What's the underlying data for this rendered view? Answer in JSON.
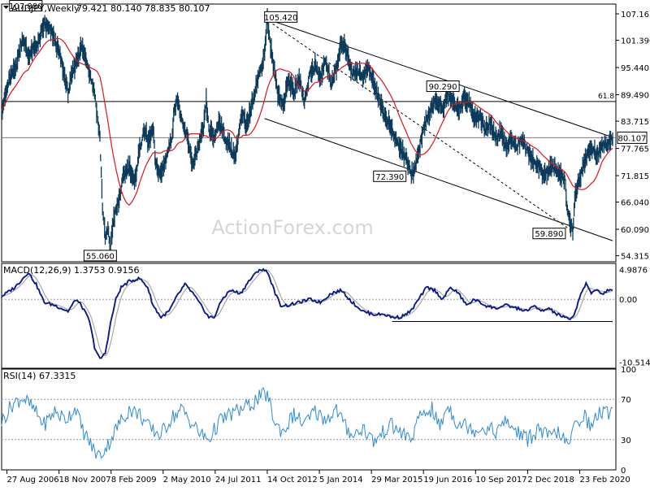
{
  "header": {
    "symbol_line": "AUDJPY,Weekly",
    "ohlc": "79.421 80.140 78.835 80.107"
  },
  "watermark": "ActionForex.com",
  "colors": {
    "price": "#0b3a5a",
    "sma": "#e0141b",
    "macd": "#0a1a8a",
    "signal": "#a8a8a8",
    "rsi": "#2e8bd6",
    "lines": "#000000",
    "current_price_box": "#000000"
  },
  "chart_data": [
    {
      "type": "line",
      "panel": "price",
      "title": "AUDJPY,Weekly",
      "y_ticks": [
        107.165,
        101.39,
        95.44,
        89.49,
        83.715,
        77.765,
        71.815,
        66.04,
        60.09,
        54.315
      ],
      "ylim": [
        53.0,
        109.3
      ],
      "x_ticks": [
        "27 Aug 2006",
        "18 Nov 2007",
        "8 Feb 2009",
        "2 May 2010",
        "24 Jul 2011",
        "14 Oct 2012",
        "5 Jan 2014",
        "29 Mar 2015",
        "19 Jun 2016",
        "10 Sep 2017",
        "2 Dec 2018",
        "23 Feb 2020"
      ],
      "current_price": "80.107",
      "fib_label": "61.8",
      "fib_level": 88.0,
      "annotations": [
        {
          "text": "107.880",
          "value": 107.88
        },
        {
          "text": "55.060",
          "value": 55.06
        },
        {
          "text": "105.420",
          "value": 105.42
        },
        {
          "text": "72.390",
          "value": 72.39
        },
        {
          "text": "90.290",
          "value": 90.29
        },
        {
          "text": "59.890",
          "value": 59.89
        }
      ],
      "price_keypoints": [
        [
          0,
          86
        ],
        [
          3,
          93
        ],
        [
          5,
          95
        ],
        [
          8,
          102
        ],
        [
          10,
          98
        ],
        [
          14,
          101
        ],
        [
          16,
          105
        ],
        [
          19,
          103
        ],
        [
          22,
          98
        ],
        [
          25,
          90
        ],
        [
          27,
          95
        ],
        [
          30,
          100
        ],
        [
          32,
          97
        ],
        [
          35,
          90
        ],
        [
          37,
          80
        ],
        [
          38,
          65
        ],
        [
          39,
          58
        ],
        [
          40,
          60
        ],
        [
          41,
          56
        ],
        [
          42,
          62
        ],
        [
          44,
          66
        ],
        [
          46,
          72
        ],
        [
          48,
          74
        ],
        [
          50,
          70
        ],
        [
          52,
          78
        ],
        [
          54,
          82
        ],
        [
          55,
          79
        ],
        [
          57,
          82
        ],
        [
          58,
          74
        ],
        [
          60,
          72
        ],
        [
          62,
          76
        ],
        [
          64,
          80
        ],
        [
          65,
          86
        ],
        [
          66,
          89
        ],
        [
          68,
          83
        ],
        [
          70,
          80
        ],
        [
          72,
          74
        ],
        [
          74,
          78
        ],
        [
          76,
          82
        ],
        [
          77,
          88
        ],
        [
          78,
          82
        ],
        [
          80,
          80
        ],
        [
          82,
          84
        ],
        [
          84,
          80
        ],
        [
          86,
          78
        ],
        [
          88,
          76
        ],
        [
          90,
          84
        ],
        [
          91,
          85
        ],
        [
          92,
          82
        ],
        [
          94,
          87
        ],
        [
          96,
          92
        ],
        [
          98,
          96
        ],
        [
          99,
          99
        ],
        [
          100,
          106
        ],
        [
          101,
          101
        ],
        [
          102,
          97
        ],
        [
          104,
          90
        ],
        [
          106,
          87
        ],
        [
          108,
          93
        ],
        [
          110,
          90
        ],
        [
          112,
          93
        ],
        [
          114,
          88
        ],
        [
          116,
          94
        ],
        [
          118,
          96
        ],
        [
          120,
          93
        ],
        [
          122,
          97
        ],
        [
          124,
          92
        ],
        [
          126,
          95
        ],
        [
          128,
          101
        ],
        [
          130,
          99
        ],
        [
          132,
          94
        ],
        [
          134,
          95
        ],
        [
          136,
          93
        ],
        [
          138,
          96
        ],
        [
          140,
          92
        ],
        [
          142,
          89
        ],
        [
          144,
          85
        ],
        [
          146,
          83
        ],
        [
          148,
          80
        ],
        [
          150,
          78
        ],
        [
          152,
          76
        ],
        [
          154,
          72
        ],
        [
          156,
          74
        ],
        [
          158,
          80
        ],
        [
          160,
          84
        ],
        [
          162,
          87
        ],
        [
          164,
          88
        ],
        [
          166,
          86
        ],
        [
          168,
          90
        ],
        [
          170,
          88
        ],
        [
          172,
          86
        ],
        [
          174,
          89
        ],
        [
          176,
          88
        ],
        [
          178,
          84
        ],
        [
          180,
          85
        ],
        [
          182,
          82
        ],
        [
          184,
          83
        ],
        [
          186,
          80
        ],
        [
          188,
          81
        ],
        [
          190,
          78
        ],
        [
          192,
          80
        ],
        [
          194,
          78
        ],
        [
          196,
          80
        ],
        [
          198,
          77
        ],
        [
          200,
          75
        ],
        [
          202,
          74
        ],
        [
          204,
          72
        ],
        [
          206,
          73
        ],
        [
          208,
          74
        ],
        [
          210,
          72
        ],
        [
          212,
          71
        ],
        [
          213,
          64
        ],
        [
          214,
          61
        ],
        [
          215,
          60
        ],
        [
          216,
          68
        ],
        [
          218,
          72
        ],
        [
          220,
          76
        ],
        [
          222,
          78
        ],
        [
          224,
          76
        ],
        [
          226,
          78
        ],
        [
          228,
          79
        ],
        [
          230,
          80.1
        ]
      ],
      "channel_lines": [
        {
          "from": [
            99,
            106.2
          ],
          "to": [
            230,
            80.2
          ]
        },
        {
          "from": [
            99,
            84.3
          ],
          "to": [
            230,
            57.6
          ]
        },
        {
          "from": [
            99,
            106.2
          ],
          "to": [
            215,
            59.6
          ]
        }
      ],
      "horizontal_line_level": 80.1,
      "series": [
        {
          "kind": "price"
        },
        {
          "kind": "moving-average"
        }
      ]
    },
    {
      "type": "line",
      "panel": "macd",
      "title": "MACD(12,26,9) 1.3753 0.9156",
      "y_ticks": [
        4.9876,
        0.0,
        -10.5142
      ],
      "ylim": [
        -11.5,
        6.0
      ],
      "support_level": -3.7,
      "keypoints": [
        [
          0,
          0.5
        ],
        [
          5,
          2
        ],
        [
          10,
          4.5
        ],
        [
          13,
          2.5
        ],
        [
          16,
          -0.5
        ],
        [
          20,
          -1
        ],
        [
          25,
          -2
        ],
        [
          28,
          0
        ],
        [
          30,
          -1
        ],
        [
          33,
          -3.5
        ],
        [
          35,
          -8
        ],
        [
          37,
          -10
        ],
        [
          39,
          -9
        ],
        [
          41,
          -4
        ],
        [
          43,
          0
        ],
        [
          45,
          2
        ],
        [
          48,
          3
        ],
        [
          52,
          3.5
        ],
        [
          55,
          2
        ],
        [
          57,
          -1
        ],
        [
          60,
          -3
        ],
        [
          63,
          -2
        ],
        [
          66,
          0.5
        ],
        [
          69,
          2.5
        ],
        [
          72,
          1
        ],
        [
          75,
          -1
        ],
        [
          78,
          -3
        ],
        [
          80,
          -3
        ],
        [
          83,
          0
        ],
        [
          86,
          1.5
        ],
        [
          90,
          1
        ],
        [
          93,
          3
        ],
        [
          97,
          5
        ],
        [
          100,
          4.7
        ],
        [
          103,
          1
        ],
        [
          105,
          -1
        ],
        [
          108,
          -1
        ],
        [
          112,
          -0.5
        ],
        [
          116,
          0
        ],
        [
          120,
          -0.5
        ],
        [
          124,
          1
        ],
        [
          128,
          1.5
        ],
        [
          132,
          -0.5
        ],
        [
          136,
          -2
        ],
        [
          140,
          -2.5
        ],
        [
          144,
          -2.5
        ],
        [
          147,
          -3
        ],
        [
          150,
          -3
        ],
        [
          154,
          -2
        ],
        [
          157,
          0
        ],
        [
          160,
          2
        ],
        [
          163,
          1.5
        ],
        [
          166,
          0
        ],
        [
          169,
          2
        ],
        [
          172,
          1
        ],
        [
          175,
          -1
        ],
        [
          178,
          0
        ],
        [
          182,
          -1
        ],
        [
          186,
          -1.5
        ],
        [
          190,
          -1
        ],
        [
          194,
          -1.5
        ],
        [
          198,
          -2
        ],
        [
          200,
          -1
        ],
        [
          203,
          -2
        ],
        [
          206,
          -1.5
        ],
        [
          209,
          -2.5
        ],
        [
          212,
          -3
        ],
        [
          214,
          -3.5
        ],
        [
          216,
          -2
        ],
        [
          218,
          1
        ],
        [
          220,
          2.5
        ],
        [
          222,
          1
        ],
        [
          224,
          1.8
        ],
        [
          226,
          0.8
        ],
        [
          228,
          1.5
        ],
        [
          230,
          1.4
        ]
      ]
    },
    {
      "type": "line",
      "panel": "rsi",
      "title": "RSI(14) 67.3315",
      "y_ticks": [
        100,
        70,
        30,
        0
      ],
      "ylim": [
        0,
        100
      ],
      "levels": [
        70,
        30
      ],
      "keypoints": [
        [
          0,
          48
        ],
        [
          4,
          65
        ],
        [
          8,
          72
        ],
        [
          12,
          60
        ],
        [
          16,
          45
        ],
        [
          20,
          58
        ],
        [
          24,
          50
        ],
        [
          28,
          62
        ],
        [
          30,
          42
        ],
        [
          33,
          28
        ],
        [
          35,
          18
        ],
        [
          37,
          14
        ],
        [
          40,
          25
        ],
        [
          44,
          45
        ],
        [
          48,
          60
        ],
        [
          52,
          55
        ],
        [
          56,
          40
        ],
        [
          60,
          35
        ],
        [
          64,
          52
        ],
        [
          68,
          60
        ],
        [
          72,
          45
        ],
        [
          75,
          35
        ],
        [
          78,
          30
        ],
        [
          82,
          48
        ],
        [
          86,
          55
        ],
        [
          90,
          60
        ],
        [
          94,
          65
        ],
        [
          97,
          72
        ],
        [
          100,
          75
        ],
        [
          103,
          45
        ],
        [
          106,
          38
        ],
        [
          110,
          55
        ],
        [
          114,
          45
        ],
        [
          118,
          58
        ],
        [
          122,
          50
        ],
        [
          126,
          60
        ],
        [
          130,
          40
        ],
        [
          133,
          35
        ],
        [
          136,
          42
        ],
        [
          140,
          28
        ],
        [
          143,
          35
        ],
        [
          146,
          45
        ],
        [
          150,
          38
        ],
        [
          154,
          30
        ],
        [
          158,
          55
        ],
        [
          162,
          60
        ],
        [
          165,
          42
        ],
        [
          168,
          65
        ],
        [
          171,
          48
        ],
        [
          174,
          45
        ],
        [
          178,
          40
        ],
        [
          182,
          42
        ],
        [
          186,
          38
        ],
        [
          190,
          48
        ],
        [
          194,
          38
        ],
        [
          198,
          30
        ],
        [
          202,
          40
        ],
        [
          206,
          32
        ],
        [
          210,
          38
        ],
        [
          213,
          22
        ],
        [
          216,
          45
        ],
        [
          219,
          55
        ],
        [
          222,
          42
        ],
        [
          225,
          58
        ],
        [
          228,
          55
        ],
        [
          230,
          67
        ]
      ]
    }
  ]
}
